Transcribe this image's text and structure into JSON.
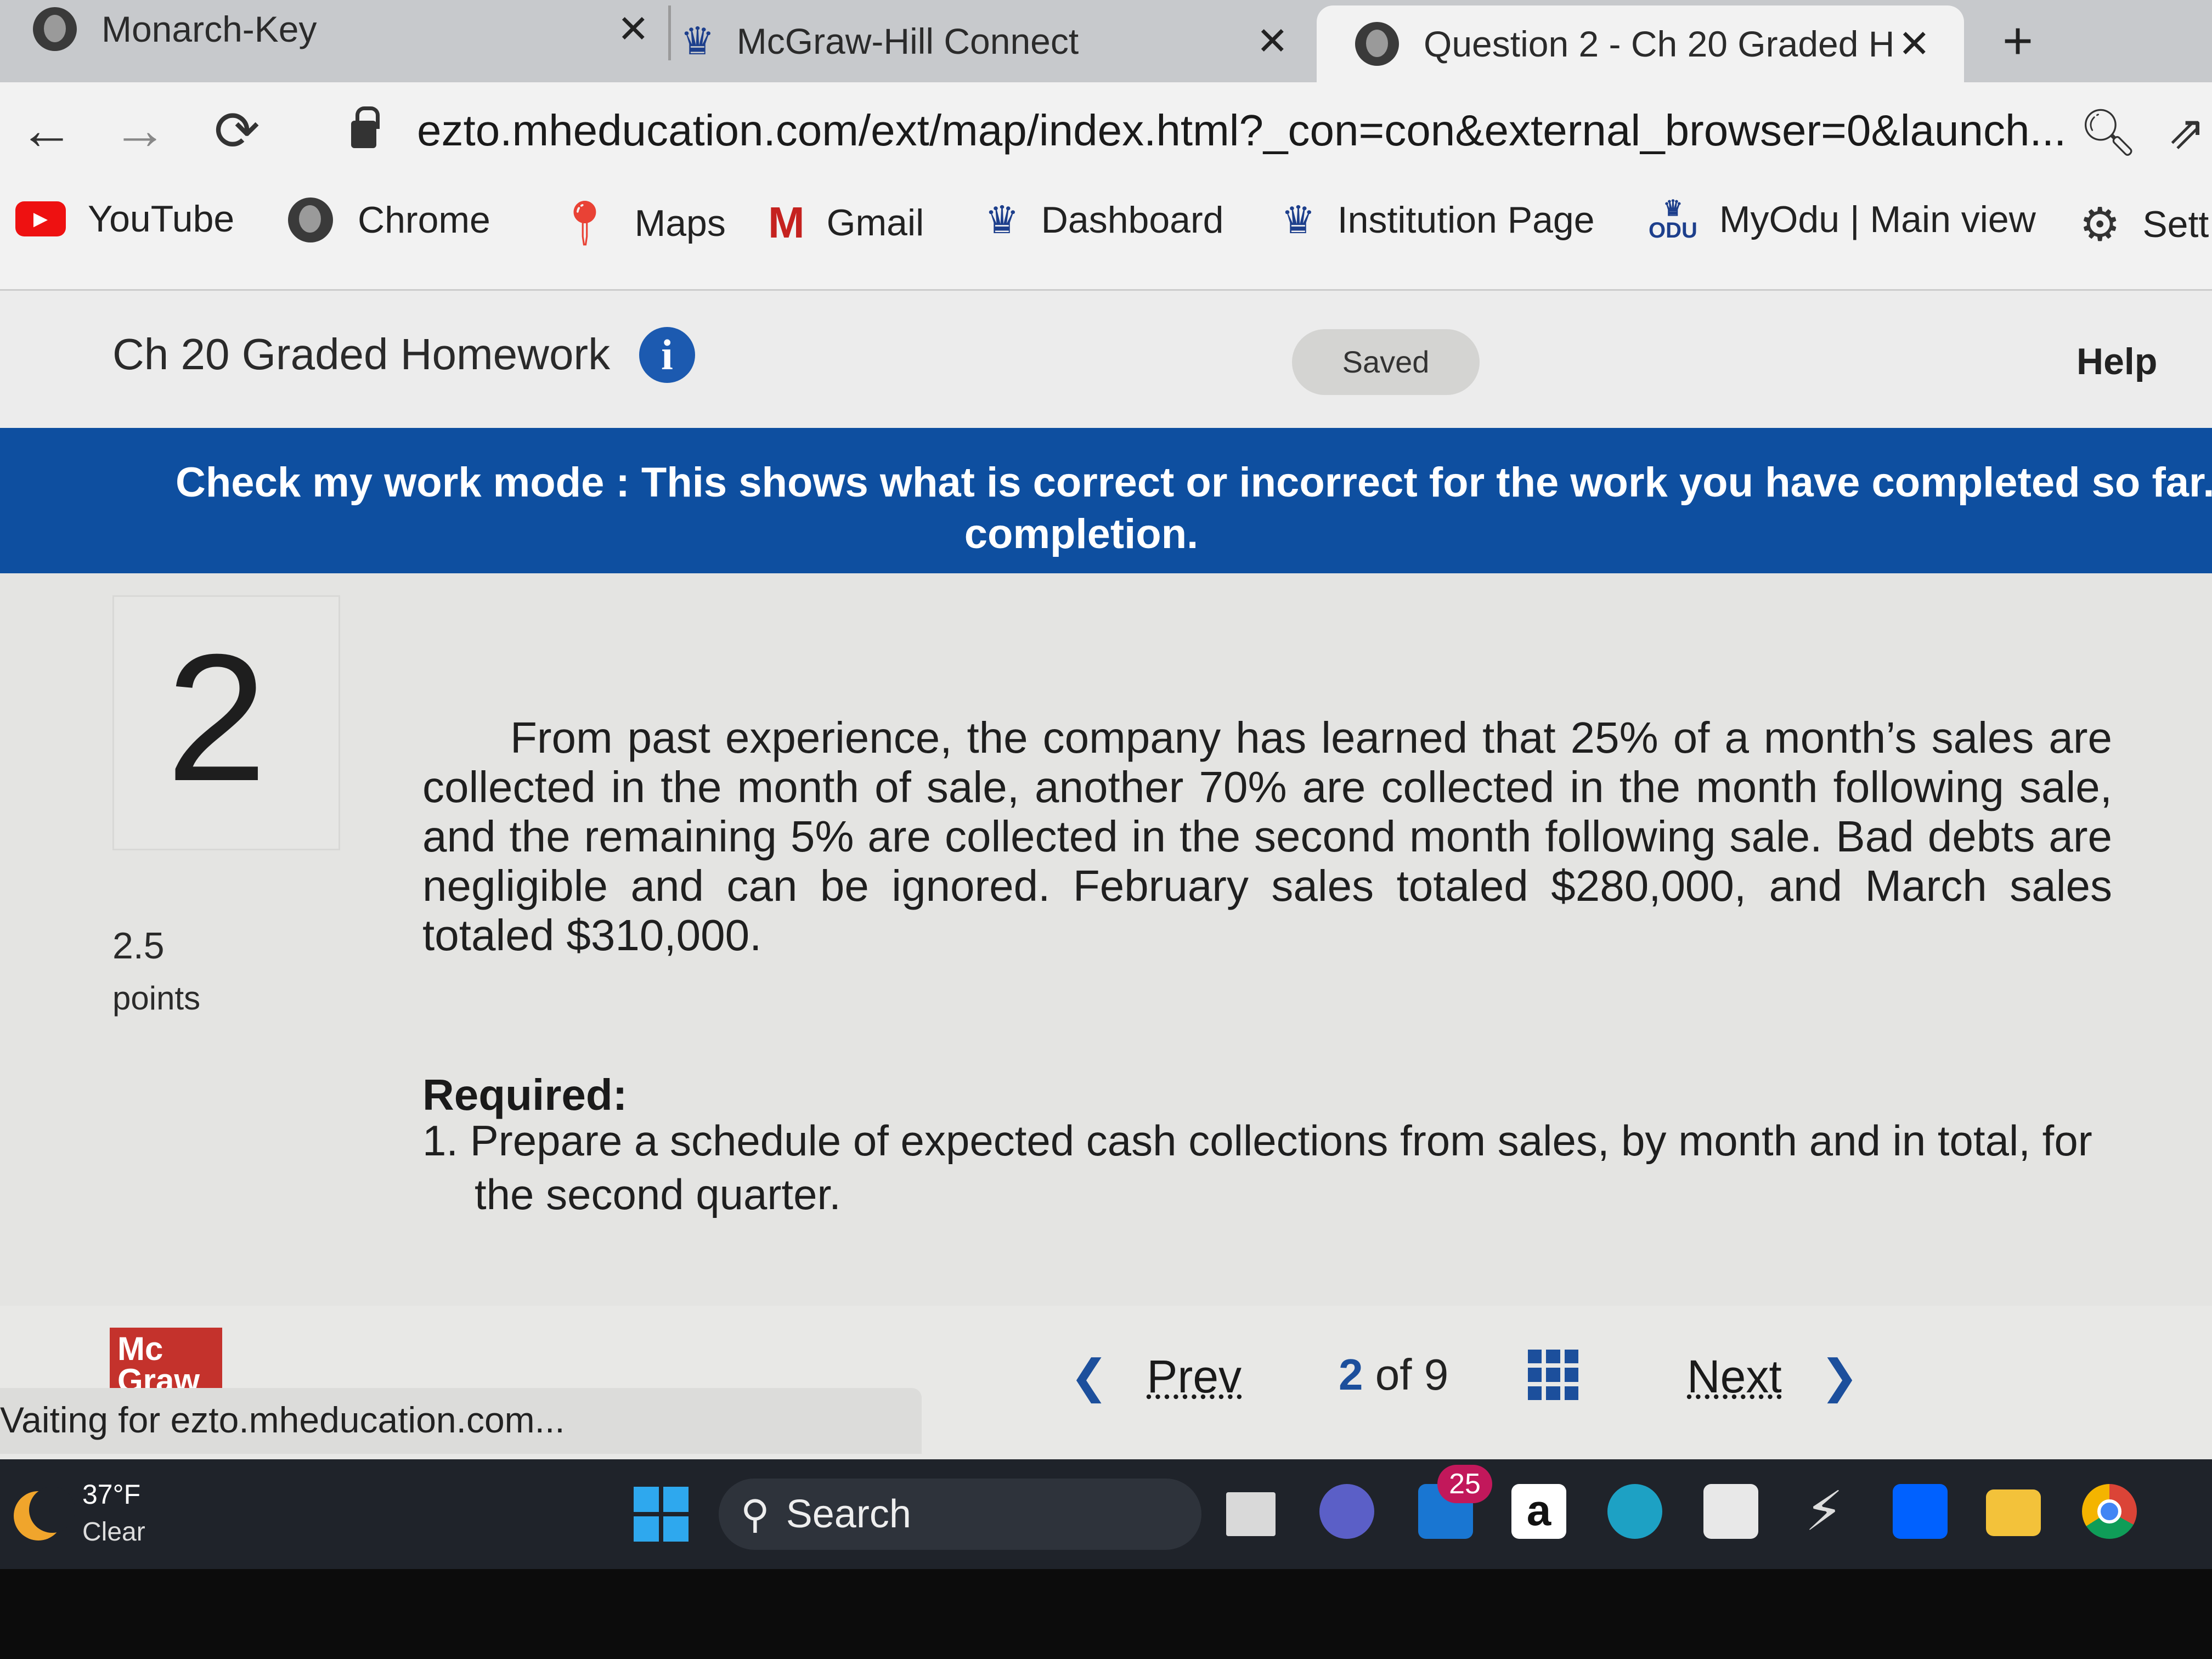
{
  "browser": {
    "tabs": [
      {
        "title": "Monarch-Key",
        "close": "✕"
      },
      {
        "title": "McGraw-Hill Connect",
        "close": "✕"
      },
      {
        "title": "Question 2 - Ch 20 Graded H",
        "close": "✕",
        "active": true
      }
    ],
    "new_tab": "+",
    "url": "ezto.mheducation.com/ext/map/index.html?_con=con&external_browser=0&launch...",
    "bookmarks": [
      {
        "label": "YouTube",
        "icon": "youtube-icon"
      },
      {
        "label": "Chrome",
        "icon": "globe-icon"
      },
      {
        "label": "Maps",
        "icon": "maps-pin-icon"
      },
      {
        "label": "Gmail",
        "icon": "gmail-icon"
      },
      {
        "label": "Dashboard",
        "icon": "crown-icon"
      },
      {
        "label": "Institution Page",
        "icon": "crown-icon"
      },
      {
        "label": "MyOdu | Main view",
        "icon": "odu-icon"
      },
      {
        "label": "Sett",
        "icon": "gear-icon"
      }
    ],
    "odu_text": "ODU"
  },
  "app": {
    "title": "Ch 20 Graded Homework",
    "saved_label": "Saved",
    "help_label": "Help"
  },
  "banner": {
    "line1": "Check my work mode : This shows what is correct or incorrect for the work you have completed so far. I",
    "line2": "completion."
  },
  "question": {
    "number": "2",
    "points_value": "2.5",
    "points_label": "points",
    "text": "From past experience, the company has learned that 25% of a month’s sales are collected in the month of sale, another 70% are collected in the month following sale, and the remaining 5% are collected in the second month following sale. Bad debts are negligible and can be ignored. February sales totaled $280,000, and March sales totaled $310,000.",
    "required_label": "Required:",
    "required_item": "1. Prepare a schedule of expected cash collections from sales, by month and in total, for the second quarter."
  },
  "footer": {
    "logo_line1": "Mc",
    "logo_line2": "Graw",
    "prev_label": "Prev",
    "current_page": "2",
    "of_label": "of",
    "total_pages": "9",
    "next_label": "Next",
    "status_text": "Vaiting for ezto.mheducation.com..."
  },
  "taskbar": {
    "temperature": "37°F",
    "condition": "Clear",
    "search_label": "Search",
    "mail_badge": "25",
    "amazon_label": "a"
  },
  "colors": {
    "banner_blue": "#0e4fa0",
    "accent_blue": "#1c4f9c",
    "logo_red": "#c4322c"
  }
}
